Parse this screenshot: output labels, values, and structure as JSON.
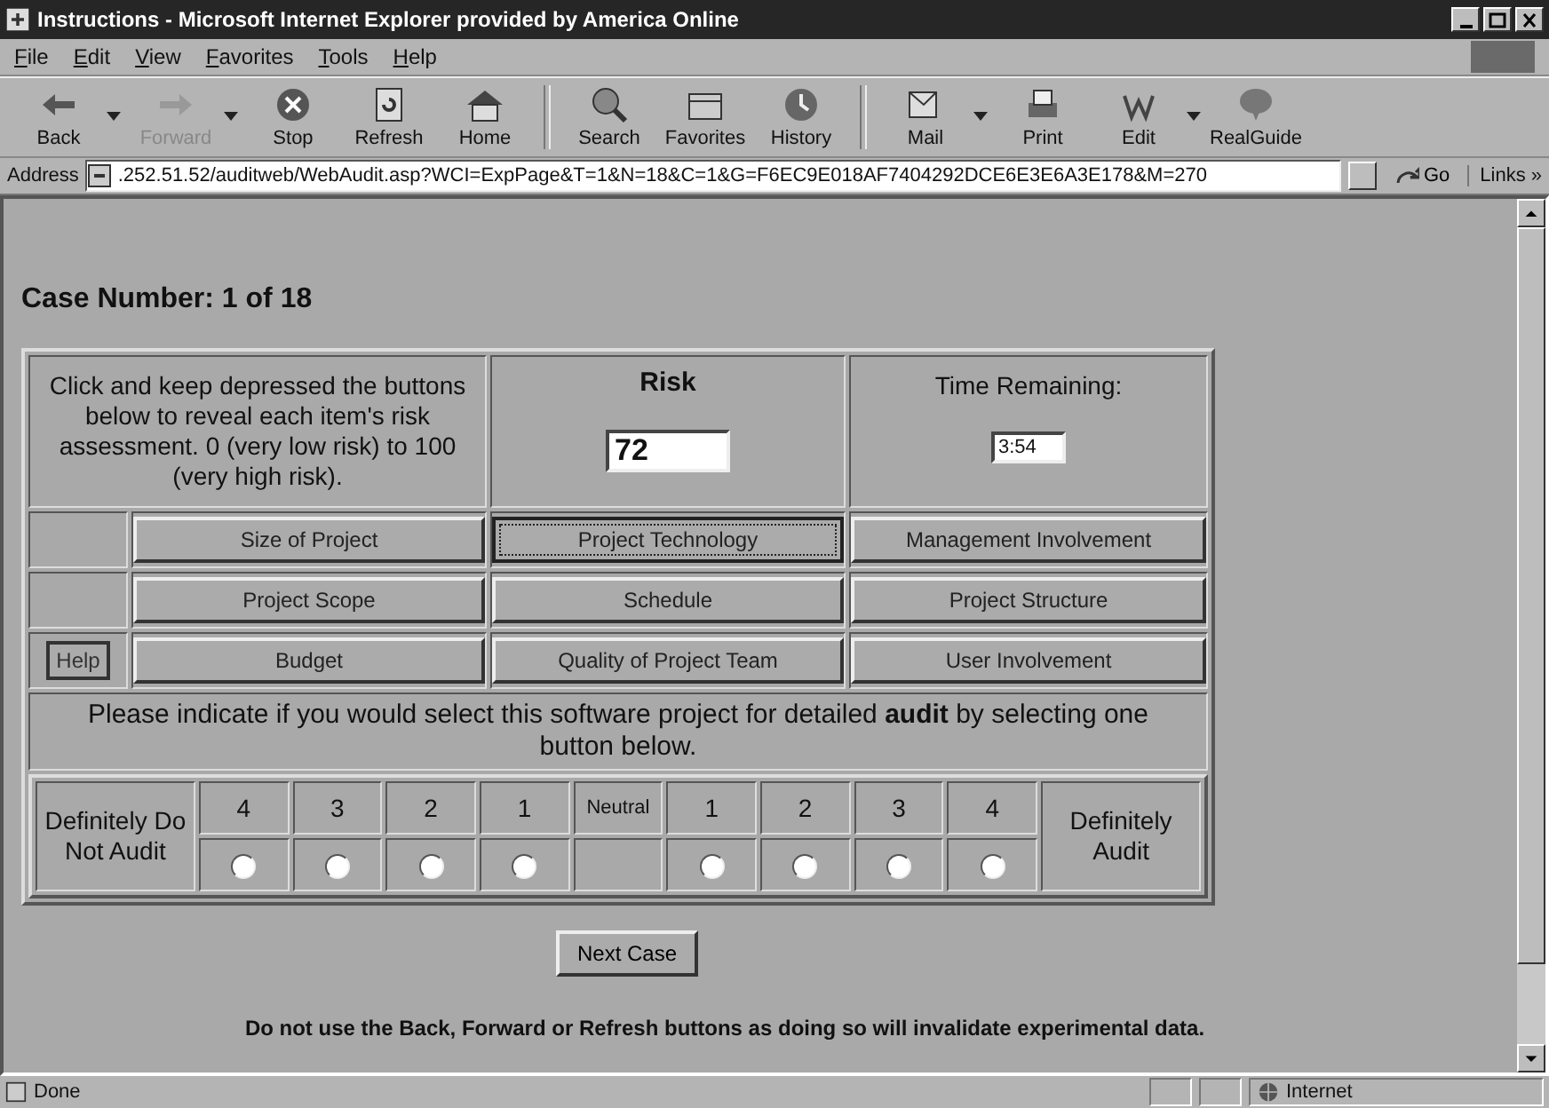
{
  "window": {
    "title": "Instructions - Microsoft Internet Explorer provided by America Online"
  },
  "menu": [
    "File",
    "Edit",
    "View",
    "Favorites",
    "Tools",
    "Help"
  ],
  "toolbar": [
    {
      "kind": "back",
      "label": "Back",
      "disabled": false,
      "dropdown": true
    },
    {
      "kind": "forward",
      "label": "Forward",
      "disabled": true,
      "dropdown": true
    },
    {
      "kind": "stop",
      "label": "Stop",
      "disabled": false,
      "dropdown": false
    },
    {
      "kind": "refresh",
      "label": "Refresh",
      "disabled": false,
      "dropdown": false
    },
    {
      "kind": "home",
      "label": "Home",
      "disabled": false,
      "dropdown": false
    },
    {
      "kind": "separator"
    },
    {
      "kind": "search",
      "label": "Search",
      "disabled": false,
      "dropdown": false
    },
    {
      "kind": "favorites",
      "label": "Favorites",
      "disabled": false,
      "dropdown": false
    },
    {
      "kind": "history",
      "label": "History",
      "disabled": false,
      "dropdown": false
    },
    {
      "kind": "separator"
    },
    {
      "kind": "mail",
      "label": "Mail",
      "disabled": false,
      "dropdown": true
    },
    {
      "kind": "print",
      "label": "Print",
      "disabled": false,
      "dropdown": false
    },
    {
      "kind": "edit",
      "label": "Edit",
      "disabled": false,
      "dropdown": true
    },
    {
      "kind": "realguide",
      "label": "RealGuide",
      "disabled": false,
      "dropdown": false
    }
  ],
  "address": {
    "label": "Address",
    "url": ".252.51.52/auditweb/WebAudit.asp?WCI=ExpPage&T=1&N=18&C=1&G=F6EC9E018AF7404292DCE6E3E6A3E178&M=270",
    "go": "Go",
    "links": "Links »"
  },
  "page": {
    "case_number": "Case Number: 1 of 18",
    "instructions": "Click and keep depressed the buttons below to reveal each item's risk assessment. 0 (very low risk) to 100 (very high risk).",
    "risk_label": "Risk",
    "risk_value": "72",
    "time_label": "Time Remaining:",
    "time_value": "3:54",
    "factor_rows": [
      [
        {
          "label": "Size of Project",
          "focused": false
        },
        {
          "label": "Project Technology",
          "focused": true
        },
        {
          "label": "Management Involvement",
          "focused": false
        }
      ],
      [
        {
          "label": "Project Scope",
          "focused": false
        },
        {
          "label": "Schedule",
          "focused": false
        },
        {
          "label": "Project Structure",
          "focused": false
        }
      ],
      [
        {
          "label": "Budget",
          "focused": false
        },
        {
          "label": "Quality of Project Team",
          "focused": false
        },
        {
          "label": "User Involvement",
          "focused": false
        }
      ]
    ],
    "help": "Help",
    "prompt": "Please indicate if you would select this software project for detailed **audit** by selecting one button below.",
    "scale": {
      "left": "Definitely Do Not Audit",
      "right": "Definitely Audit",
      "options": [
        {
          "kind": "radio",
          "label": "4",
          "selected": false
        },
        {
          "kind": "radio",
          "label": "3",
          "selected": false
        },
        {
          "kind": "radio",
          "label": "2",
          "selected": false
        },
        {
          "kind": "radio",
          "label": "1",
          "selected": false
        },
        {
          "kind": "neutral",
          "label": "Neutral"
        },
        {
          "kind": "radio",
          "label": "1",
          "selected": false
        },
        {
          "kind": "radio",
          "label": "2",
          "selected": false
        },
        {
          "kind": "radio",
          "label": "3",
          "selected": false
        },
        {
          "kind": "radio",
          "label": "4",
          "selected": false
        }
      ]
    },
    "next_button": "Next Case",
    "warning": "Do not use the Back, Forward or Refresh buttons as doing so will invalidate experimental data."
  },
  "status_bar": {
    "text": "Done",
    "zone": "Internet"
  }
}
